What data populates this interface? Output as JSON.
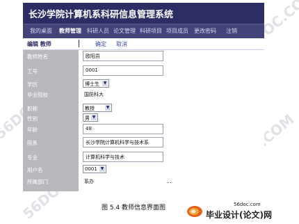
{
  "header": {
    "title": "长沙学院计算机系科研信息管理系统"
  },
  "nav": {
    "items": [
      "我的桌面",
      "教师管理",
      "科研人员",
      "论文管理",
      "科研项目",
      "项目成员",
      "更改密码",
      "注销"
    ]
  },
  "toolbar": {
    "title": "编辑 教师",
    "confirm": "确定",
    "cancel": "取消"
  },
  "form": {
    "fields": [
      {
        "label": "教师姓名",
        "value": "欧阳员"
      },
      {
        "label": "工号",
        "value": "0001"
      },
      {
        "label": "学历",
        "value": "博士生"
      },
      {
        "label": "毕业院校",
        "value": "国防科大"
      },
      {
        "label": "职称",
        "value": "教授"
      },
      {
        "label": "性别",
        "value": "男"
      },
      {
        "label": "年龄",
        "value": "48"
      },
      {
        "label": "院系",
        "value": "长沙学院计算机科学与技术系"
      },
      {
        "label": "专业",
        "value": "计算机科学与技术"
      },
      {
        "label": "用户名",
        "value": "0001"
      },
      {
        "label": "所属部门",
        "value": "系办"
      }
    ],
    "ellipsis": "..."
  },
  "caption": "图 5.4 教师信息界面图",
  "watermark": {
    "text": "56DOC.COM"
  },
  "logo": {
    "url": "56doc.com",
    "text": "毕业设计(论文)网"
  }
}
